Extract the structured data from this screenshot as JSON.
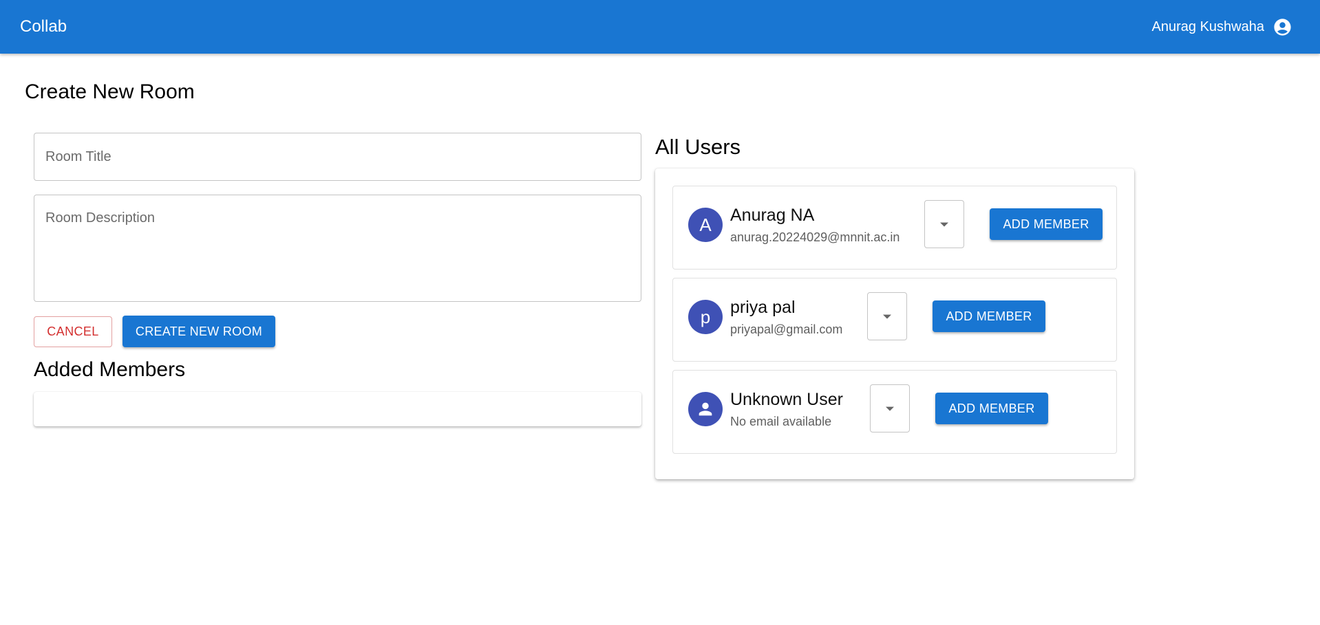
{
  "appbar": {
    "brand": "Collab",
    "user_name": "Anurag Kushwaha",
    "user_icon": "account-circle-icon"
  },
  "page": {
    "title": "Create New Room"
  },
  "form": {
    "title_placeholder": "Room Title",
    "title_value": "",
    "description_placeholder": "Room Description",
    "description_value": "",
    "cancel_label": "CANCEL",
    "create_label": "CREATE NEW ROOM"
  },
  "added_members": {
    "title": "Added Members",
    "members": []
  },
  "all_users": {
    "title": "All Users",
    "users": [
      {
        "initial": "A",
        "name": "Anurag NA",
        "email": "anurag.20224029@mnnit.ac.in",
        "role": "",
        "button_label": "ADD MEMBER"
      },
      {
        "initial": "p",
        "name": "priya pal",
        "email": "priyapal@gmail.com",
        "role": "",
        "button_label": "ADD MEMBER"
      },
      {
        "initial": "",
        "avatar_icon": "person-icon",
        "name": "Unknown User",
        "email": "No email available",
        "role": "",
        "button_label": "ADD MEMBER"
      }
    ]
  },
  "colors": {
    "primary": "#1976d2",
    "avatar": "#3f51b5",
    "error": "#d32f2f"
  }
}
